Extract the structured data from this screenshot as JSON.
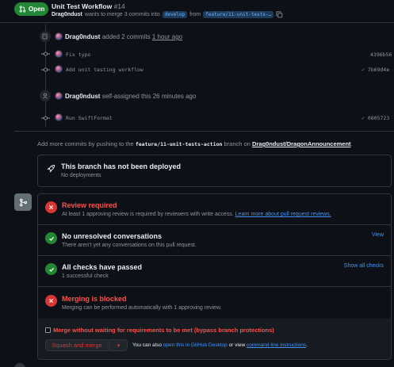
{
  "header": {
    "status_label": "Open",
    "title": "Unit Test Workflow",
    "number": "#14",
    "author": "Drag0ndust",
    "merge_text": "wants to merge 3 commits into",
    "base_branch": "develop",
    "from_text": "from",
    "head_branch": "feature/11-unit-tests-…"
  },
  "timeline": {
    "event1": {
      "user": "Drag0ndust",
      "action": "added 2 commits",
      "time": "1 hour ago"
    },
    "commits": [
      {
        "message": "Fix typo",
        "sha": "4396b56",
        "status": ""
      },
      {
        "message": "Add unit testing workflow",
        "sha": "7b69d4e",
        "status": "✓"
      }
    ],
    "event2": {
      "user": "Drag0ndust",
      "action": "self-assigned this",
      "time": "26 minutes ago"
    },
    "commits2": [
      {
        "message": "Run SwiftFormat",
        "sha": "0805723",
        "status": "✓"
      }
    ]
  },
  "add_commits": {
    "prefix": "Add more commits by pushing to the",
    "branch": "feature/11-unit-tests-action",
    "middle": "branch on",
    "repo": "Drag0ndust/DragonAnnouncement",
    "suffix": "."
  },
  "deploy": {
    "title": "This branch has not been deployed",
    "desc": "No deployments"
  },
  "merge": {
    "rows": [
      {
        "title": "Review required",
        "desc": "At least 1 approving review is required by reviewers with write access.",
        "link": "Learn more about pull request reviews."
      },
      {
        "title": "No unresolved conversations",
        "desc": "There aren't yet any conversations on this pull request.",
        "link": "View"
      },
      {
        "title": "All checks have passed",
        "desc": "1 successful check",
        "link": "Show all checks"
      },
      {
        "title": "Merging is blocked",
        "desc": "Merging can be performed automatically with 1 approving review.",
        "link": ""
      }
    ],
    "bypass_label": "Merge without waiting for requirements to be met (bypass branch protections)",
    "squash_label": "Squash and merge",
    "hint_prefix": "You can also",
    "hint_link1": "open this in GitHub Desktop",
    "hint_middle": "or view",
    "hint_link2": "command line instructions",
    "hint_suffix": "."
  },
  "colors": {
    "accent_green": "#238636",
    "danger_red": "#da3633",
    "link_blue": "#4493f8",
    "background": "#0d1117"
  },
  "icons": [
    "git-pull-request-icon",
    "copy-icon",
    "repo-push-icon",
    "git-commit-icon",
    "person-icon",
    "rocket-icon",
    "git-merge-icon",
    "x-icon",
    "check-icon",
    "triangle-down-icon"
  ]
}
